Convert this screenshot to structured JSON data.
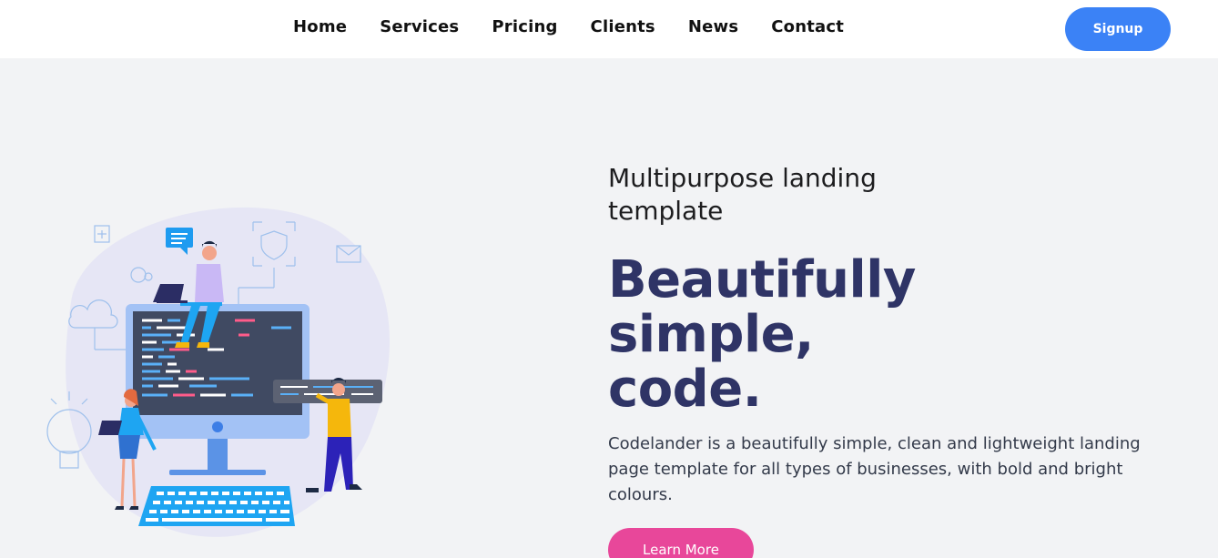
{
  "nav": {
    "links": [
      "Home",
      "Services",
      "Pricing",
      "Clients",
      "News",
      "Contact"
    ],
    "signup_label": "Signup"
  },
  "hero": {
    "eyebrow": "Multipurpose landing template",
    "headline": "Beautifully simple, code.",
    "description": "Codelander is a beautifully simple, clean and lightweight landing page template for all types of businesses, with bold and bright colours.",
    "cta_label": "Learn More",
    "illustration": "developer-workspace-illustration"
  },
  "colors": {
    "accent_blue": "#3b82f6",
    "cta_pink": "#e8479a",
    "headline_navy": "#2f3466",
    "page_background": "#f2f3f5"
  }
}
